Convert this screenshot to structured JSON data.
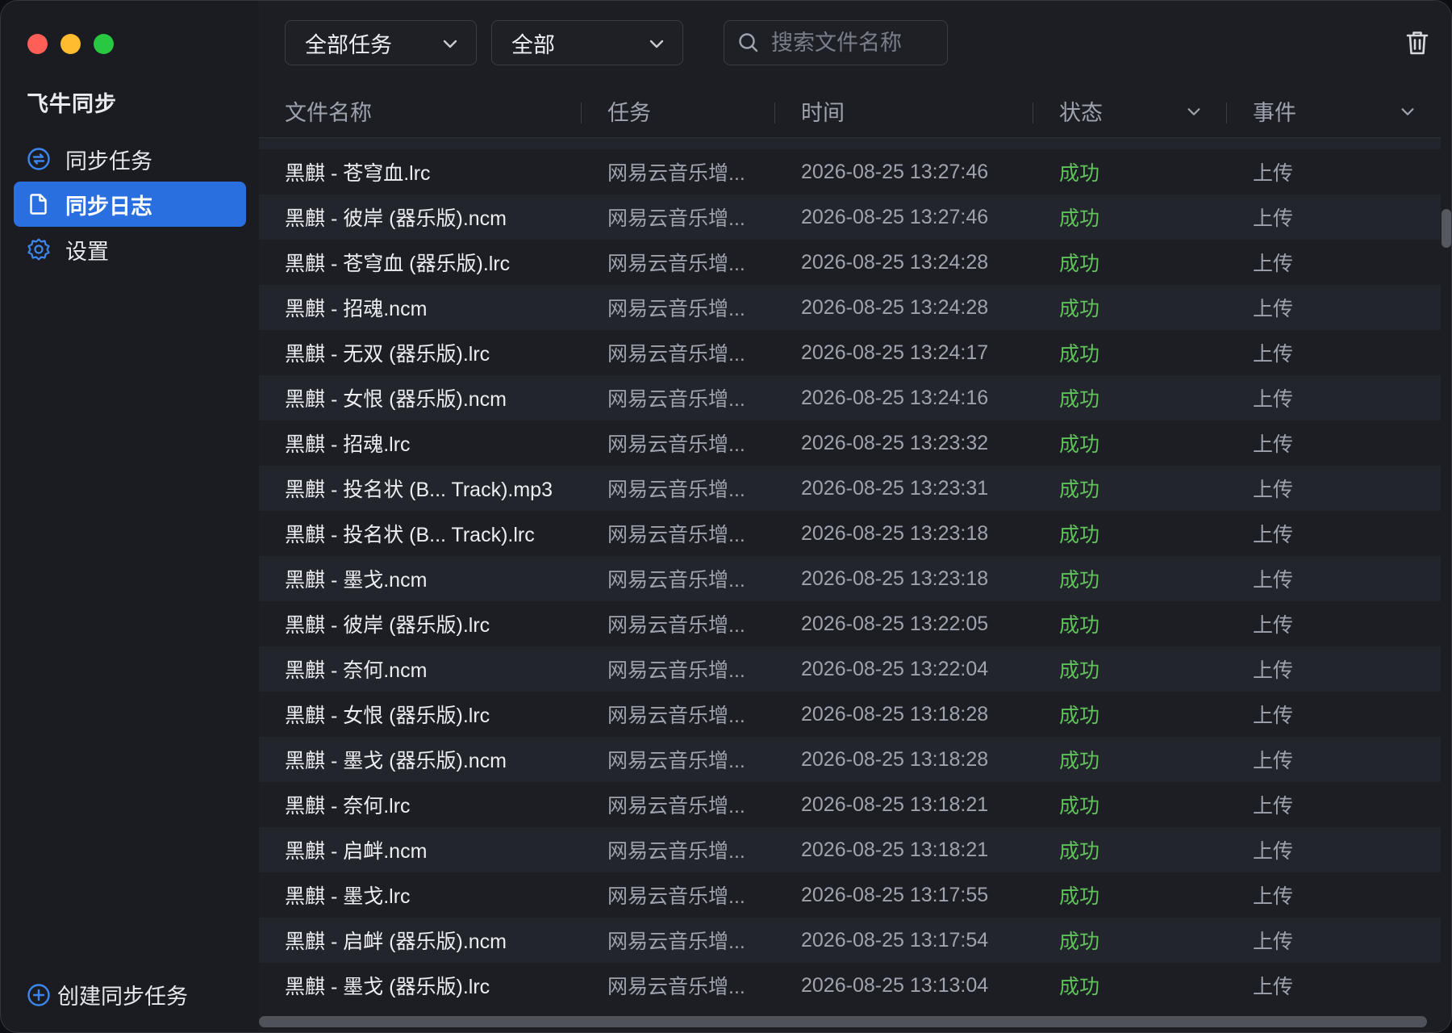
{
  "window": {
    "controls": [
      "close",
      "minimize",
      "zoom"
    ]
  },
  "sidebar": {
    "app_title": "飞牛同步",
    "items": [
      {
        "label": "同步任务",
        "icon": "sync-icon",
        "active": false
      },
      {
        "label": "同步日志",
        "icon": "document-icon",
        "active": true
      },
      {
        "label": "设置",
        "icon": "gear-icon",
        "active": false
      }
    ],
    "create_label": "创建同步任务"
  },
  "toolbar": {
    "task_filter": "全部任务",
    "type_filter": "全部",
    "search_placeholder": "搜索文件名称",
    "trash_icon": "trash-icon"
  },
  "table": {
    "headers": {
      "name": "文件名称",
      "task": "任务",
      "time": "时间",
      "status": "状态",
      "event": "事件"
    },
    "rows": [
      {
        "name": "黑麒 - 苍穹血.lrc",
        "task": "网易云音乐增...",
        "time": "2026-08-25 13:27:46",
        "status": "成功",
        "event": "上传"
      },
      {
        "name": "黑麒 - 彼岸 (器乐版).ncm",
        "task": "网易云音乐增...",
        "time": "2026-08-25 13:27:46",
        "status": "成功",
        "event": "上传"
      },
      {
        "name": "黑麒 - 苍穹血 (器乐版).lrc",
        "task": "网易云音乐增...",
        "time": "2026-08-25 13:24:28",
        "status": "成功",
        "event": "上传"
      },
      {
        "name": "黑麒 - 招魂.ncm",
        "task": "网易云音乐增...",
        "time": "2026-08-25 13:24:28",
        "status": "成功",
        "event": "上传"
      },
      {
        "name": "黑麒 - 无双 (器乐版).lrc",
        "task": "网易云音乐增...",
        "time": "2026-08-25 13:24:17",
        "status": "成功",
        "event": "上传"
      },
      {
        "name": "黑麒 - 女恨 (器乐版).ncm",
        "task": "网易云音乐增...",
        "time": "2026-08-25 13:24:16",
        "status": "成功",
        "event": "上传"
      },
      {
        "name": "黑麒 - 招魂.lrc",
        "task": "网易云音乐增...",
        "time": "2026-08-25 13:23:32",
        "status": "成功",
        "event": "上传"
      },
      {
        "name": "黑麒 - 投名状 (B... Track).mp3",
        "task": "网易云音乐增...",
        "time": "2026-08-25 13:23:31",
        "status": "成功",
        "event": "上传"
      },
      {
        "name": "黑麒 - 投名状 (B... Track).lrc",
        "task": "网易云音乐增...",
        "time": "2026-08-25 13:23:18",
        "status": "成功",
        "event": "上传"
      },
      {
        "name": "黑麒 - 墨戈.ncm",
        "task": "网易云音乐增...",
        "time": "2026-08-25 13:23:18",
        "status": "成功",
        "event": "上传"
      },
      {
        "name": "黑麒 - 彼岸 (器乐版).lrc",
        "task": "网易云音乐增...",
        "time": "2026-08-25 13:22:05",
        "status": "成功",
        "event": "上传"
      },
      {
        "name": "黑麒 - 奈何.ncm",
        "task": "网易云音乐增...",
        "time": "2026-08-25 13:22:04",
        "status": "成功",
        "event": "上传"
      },
      {
        "name": "黑麒 - 女恨 (器乐版).lrc",
        "task": "网易云音乐增...",
        "time": "2026-08-25 13:18:28",
        "status": "成功",
        "event": "上传"
      },
      {
        "name": "黑麒 - 墨戈 (器乐版).ncm",
        "task": "网易云音乐增...",
        "time": "2026-08-25 13:18:28",
        "status": "成功",
        "event": "上传"
      },
      {
        "name": "黑麒 - 奈何.lrc",
        "task": "网易云音乐增...",
        "time": "2026-08-25 13:18:21",
        "status": "成功",
        "event": "上传"
      },
      {
        "name": "黑麒 - 启衅.ncm",
        "task": "网易云音乐增...",
        "time": "2026-08-25 13:18:21",
        "status": "成功",
        "event": "上传"
      },
      {
        "name": "黑麒 - 墨戈.lrc",
        "task": "网易云音乐增...",
        "time": "2026-08-25 13:17:55",
        "status": "成功",
        "event": "上传"
      },
      {
        "name": "黑麒 - 启衅 (器乐版).ncm",
        "task": "网易云音乐增...",
        "time": "2026-08-25 13:17:54",
        "status": "成功",
        "event": "上传"
      },
      {
        "name": "黑麒 - 墨戈 (器乐版).lrc",
        "task": "网易云音乐增...",
        "time": "2026-08-25 13:13:04",
        "status": "成功",
        "event": "上传"
      }
    ]
  },
  "colors": {
    "accent": "#2a6fe0",
    "success": "#5fc35a",
    "background": "#1c1e24",
    "sidebar": "#1a1c21"
  }
}
